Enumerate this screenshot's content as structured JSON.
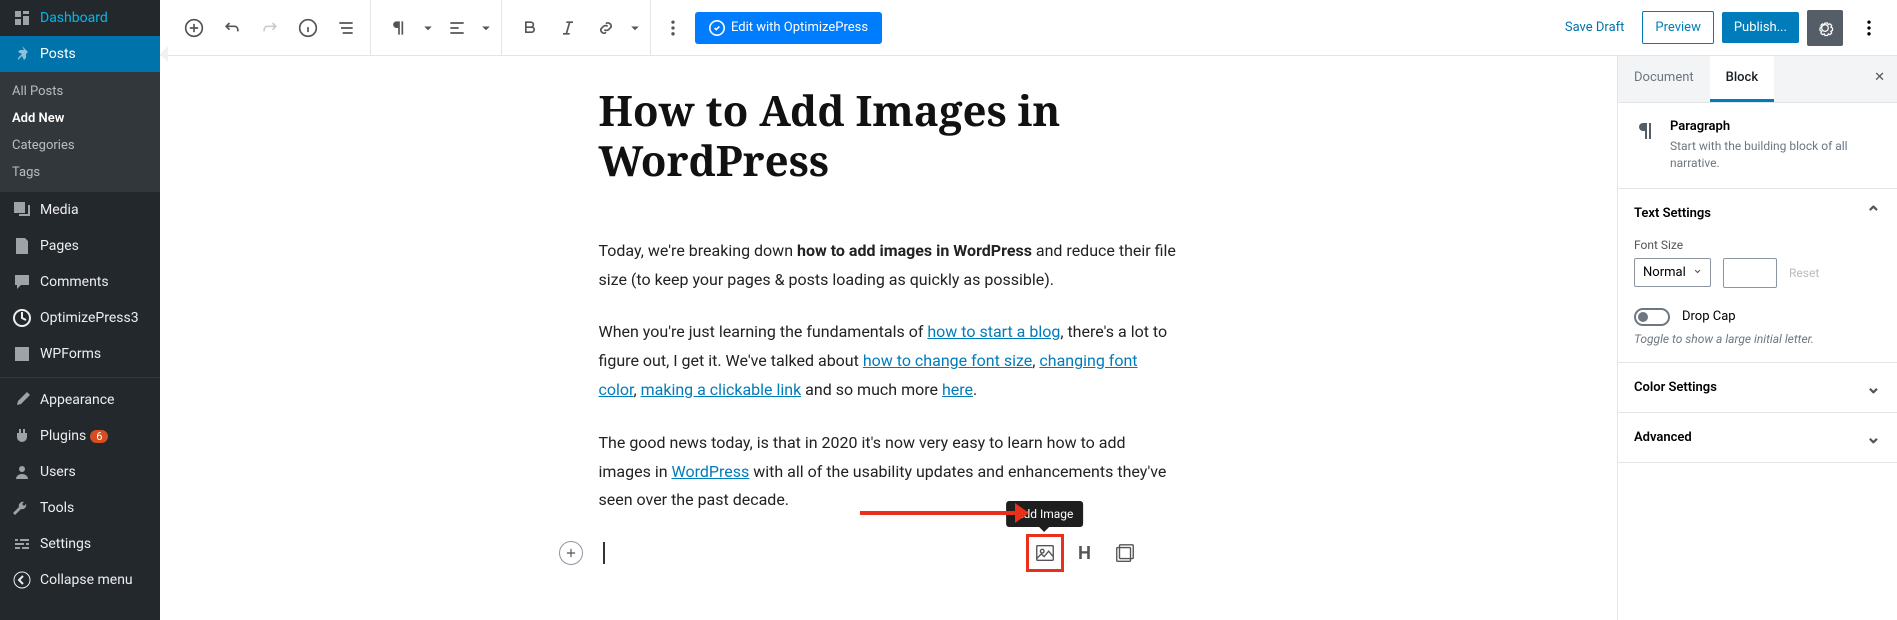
{
  "sidebar": {
    "dashboard": "Dashboard",
    "posts": "Posts",
    "posts_sub": [
      "All Posts",
      "Add New",
      "Categories",
      "Tags"
    ],
    "media": "Media",
    "pages": "Pages",
    "comments": "Comments",
    "optimizepress": "OptimizePress3",
    "wpforms": "WPForms",
    "appearance": "Appearance",
    "plugins": "Plugins",
    "plugins_badge": "6",
    "users": "Users",
    "tools": "Tools",
    "settings": "Settings",
    "collapse": "Collapse menu"
  },
  "toolbar": {
    "edit_with_op": "Edit with OptimizePress",
    "save_draft": "Save Draft",
    "preview": "Preview",
    "publish": "Publish..."
  },
  "post": {
    "title": "How to Add Images in WordPress",
    "p1a": "Today, we're breaking down ",
    "p1b": "how to add images in WordPress",
    "p1c": " and reduce their file size (to keep your pages & posts loading as quickly as possible).",
    "p2a": "When you're just learning the fundamentals of ",
    "link1": "how to start a blog",
    "p2b": ", there's a lot to figure out, I get it. We've talked about ",
    "link2": "how to change font size",
    "p2c": ", ",
    "link3": "changing font color",
    "p2d": ", ",
    "link4": "making a clickable link",
    "p2e": " and so much more ",
    "link5": "here",
    "p2f": ".",
    "p3a": "The good news today, is that in 2020 it's now very easy to learn how to add images in ",
    "link6": "WordPress",
    "p3b": " with all of the usability updates and enhancements they've seen over the past decade."
  },
  "inline": {
    "tooltip": "Add Image",
    "heading_letter": "H"
  },
  "panel": {
    "tab_document": "Document",
    "tab_block": "Block",
    "block_name": "Paragraph",
    "block_desc": "Start with the building block of all narrative.",
    "text_settings": "Text Settings",
    "font_size_label": "Font Size",
    "font_size_value": "Normal",
    "reset": "Reset",
    "drop_cap": "Drop Cap",
    "drop_cap_help": "Toggle to show a large initial letter.",
    "color_settings": "Color Settings",
    "advanced": "Advanced"
  }
}
